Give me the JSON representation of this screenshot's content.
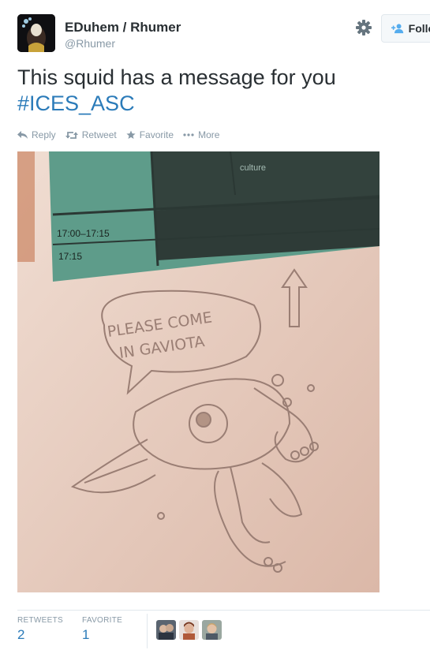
{
  "account": {
    "display_name": "EDuhem / Rhumer",
    "screen_name": "@Rhumer",
    "follow_label": "Follow"
  },
  "tweet": {
    "text": "This squid has a message for you",
    "hashtag": "#ICES_ASC"
  },
  "actions": {
    "reply": "Reply",
    "retweet": "Retweet",
    "favorite": "Favorite",
    "more": "More"
  },
  "photo": {
    "schedule_times": [
      "17:00–17:15",
      "17:15"
    ],
    "schedule_fragment": "culture",
    "speech_bubble_line1": "PLEASE COME",
    "speech_bubble_line2": "IN GAVIOTA"
  },
  "stats": {
    "retweets_label": "RETWEETS",
    "retweets_count": "2",
    "favorites_label": "FAVORITE",
    "favorites_count": "1"
  },
  "colors": {
    "link": "#2b7bb9",
    "muted": "#8899a6",
    "text": "#292f33",
    "border": "#e1e8ed"
  },
  "icons": [
    "avatar",
    "gear-icon",
    "follow-person-icon",
    "reply-icon",
    "retweet-icon",
    "favorite-star-icon",
    "more-dots-icon"
  ]
}
